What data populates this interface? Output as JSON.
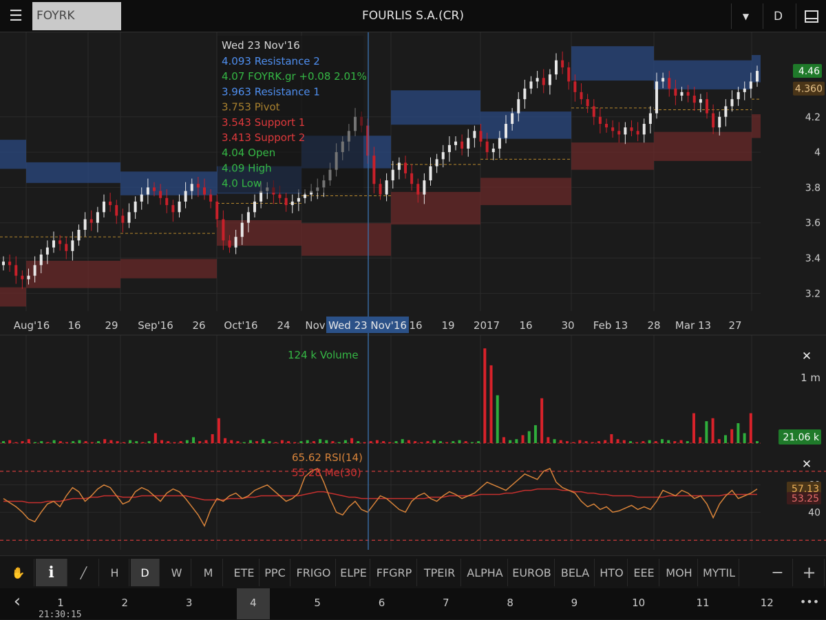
{
  "header": {
    "symbol_value": "FOYRK",
    "title": "FOURLIS  S.A.(CR)",
    "period_label": "D"
  },
  "info_panel": {
    "date": "Wed 23 Nov'16",
    "lines": [
      {
        "text": "4.093 Resistance 2",
        "color": "#4f8ff0"
      },
      {
        "text": "4.07 FOYRK.gr +0.08 2.01%",
        "color": "#35b845"
      },
      {
        "text": "3.963 Resistance 1",
        "color": "#4f8ff0"
      },
      {
        "text": "3.753 Pivot",
        "color": "#a9812e"
      },
      {
        "text": "3.543 Support 1",
        "color": "#e0393c"
      },
      {
        "text": "3.413 Support 2",
        "color": "#e0393c"
      },
      {
        "text": "4.04 Open",
        "color": "#35b845"
      },
      {
        "text": "4.09 High",
        "color": "#35b845"
      },
      {
        "text": "4.0 Low",
        "color": "#35b845"
      }
    ]
  },
  "price_chart": {
    "y_ticks": [
      "4.2",
      "4",
      "3.8",
      "3.6",
      "3.4",
      "3.2"
    ],
    "y_range": [
      3.1,
      4.62
    ],
    "last_price": "4.46",
    "prev_price": "4.360",
    "x_labels": [
      "Aug'16",
      "16",
      "29",
      "Sep'16",
      "26",
      "Oct'16",
      "24",
      "Nov",
      "16",
      "19",
      "2017",
      "16",
      "30",
      "Feb 13",
      "28",
      "Mar 13",
      "27"
    ],
    "crosshair_label": "Wed 23 Nov'16"
  },
  "volume_chart": {
    "label": "124 k Volume",
    "scale_label": "1 m",
    "last_value": "21.06 k"
  },
  "rsi_chart": {
    "rsi_label": "65.62 RSI(14)",
    "me_label": "55.28 Me(30)",
    "y_ticks": [
      "60",
      "40"
    ],
    "last_rsi": "57.13",
    "last_me": "53.25"
  },
  "toolbar": {
    "tools": [
      {
        "icon": "hand-icon",
        "symbol": "✋"
      },
      {
        "icon": "info-icon",
        "symbol": "i"
      },
      {
        "icon": "line-icon",
        "symbol": "╱"
      }
    ],
    "periods": [
      "H",
      "D",
      "W",
      "M"
    ],
    "active_period": "D",
    "symbols": [
      "ETE",
      "PPC",
      "FRIGO",
      "ELPE",
      "FFGRP",
      "TPEIR",
      "ALPHA",
      "EUROB",
      "BELA",
      "HTO",
      "EEE",
      "MOH",
      "MYTIL"
    ],
    "minus": "−",
    "plus": "+"
  },
  "pager": {
    "pages": [
      "1",
      "2",
      "3",
      "4",
      "5",
      "6",
      "7",
      "8",
      "9",
      "10",
      "11",
      "12"
    ],
    "active": "4",
    "more": "•••",
    "back": "‹"
  },
  "clock": "21:30:15",
  "colors": {
    "up": "#e8e8e8",
    "down": "#c8202a",
    "resistance": "#2b4a82",
    "support": "#6a2a2a",
    "pivot": "#b8892e",
    "rsi": "#d9843a",
    "me": "#c8302e",
    "vol_up": "#2fae3c",
    "vol_down": "#d8222a"
  }
}
